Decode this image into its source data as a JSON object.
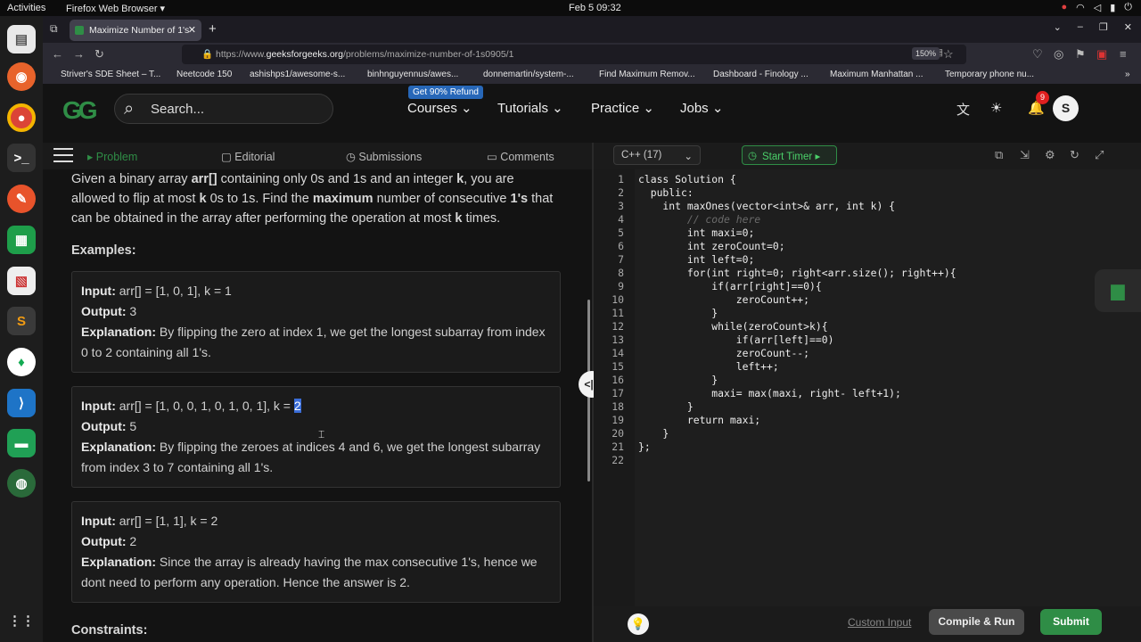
{
  "system": {
    "activities": "Activities",
    "app_name": "Firefox Web Browser ▾",
    "clock": "Feb 5  09:32"
  },
  "browser": {
    "tab_title": "Maximize Number of 1's",
    "url_prefix": "https://www.",
    "url_host": "geeksforgeeks.org",
    "url_path": "/problems/maximize-number-of-1s0905/1",
    "zoom": "150%",
    "bookmarks": [
      "Striver's SDE Sheet – T...",
      "Neetcode 150",
      "ashishps1/awesome-s...",
      "binhnguyennus/awes...",
      "donnemartin/system-...",
      "Find Maximum Remov...",
      "Dashboard - Finology ...",
      "Maximum Manhattan ...",
      "Temporary phone nu..."
    ]
  },
  "header": {
    "logo": "GG",
    "search_placeholder": "Search...",
    "refund_badge": "Get 90% Refund",
    "menu": [
      "Courses",
      "Tutorials",
      "Practice",
      "Jobs"
    ],
    "notifications": "9",
    "avatar": "S"
  },
  "problem_tabs": [
    "Problem",
    "Editorial",
    "Submissions",
    "Comments"
  ],
  "problem": {
    "statement": {
      "p1": "Given a binary array ",
      "arr": "arr[]",
      "p2": " containing only 0s and 1s and an integer ",
      "k": "k",
      "p3": ", you are allowed to flip at most ",
      "k2": "k",
      "p4": " 0s to 1s. Find the ",
      "maximum": "maximum",
      "p5": " number of consecutive ",
      "ones": "1's",
      "p6": " that can be obtained in the array after performing the operation at most ",
      "k3": "k",
      "p7": " times."
    },
    "examples_heading": "Examples:",
    "input_label": "Input:",
    "output_label": "Output:",
    "explanation_label": "Explanation:",
    "examples": [
      {
        "input": "arr[] = [1, 0, 1], k = 1",
        "output": "3",
        "explanation": "By flipping the zero at index 1, we get the longest subarray from index 0 to 2 containing all 1's."
      },
      {
        "input_main": "arr[] = [1, 0, 0, 1, 0, 1, 0, 1], k = ",
        "input_selected": "2",
        "output": "5",
        "explanation": "By flipping the zeroes at indices 4 and 6, we get the longest subarray from index 3 to 7 containing all 1's."
      },
      {
        "input": "arr[] = [1, 1], k = 2",
        "output": "2",
        "explanation": "Since the array is already having the max consecutive 1's, hence we dont need to perform any operation. Hence the answer is 2."
      }
    ],
    "constraints_heading": "Constraints:"
  },
  "editor": {
    "language": "C++ (17)",
    "timer_label": "Start Timer",
    "lines": [
      "class Solution {",
      "  public:",
      "    int maxOnes(vector<int>& arr, int k) {",
      "        // code here",
      "        int maxi=0;",
      "        int zeroCount=0;",
      "        int left=0;",
      "        for(int right=0; right<arr.size(); right++){",
      "            if(arr[right]==0){",
      "                zeroCount++;",
      "            }",
      "            while(zeroCount>k){",
      "                if(arr[left]==0)",
      "                zeroCount--;",
      "                left++;",
      "            }",
      "            maxi= max(maxi, right- left+1);",
      "        }",
      "        return maxi;",
      "    }",
      "};",
      ""
    ]
  },
  "actions": {
    "custom_input": "Custom Input",
    "compile_run": "Compile & Run",
    "submit": "Submit"
  }
}
